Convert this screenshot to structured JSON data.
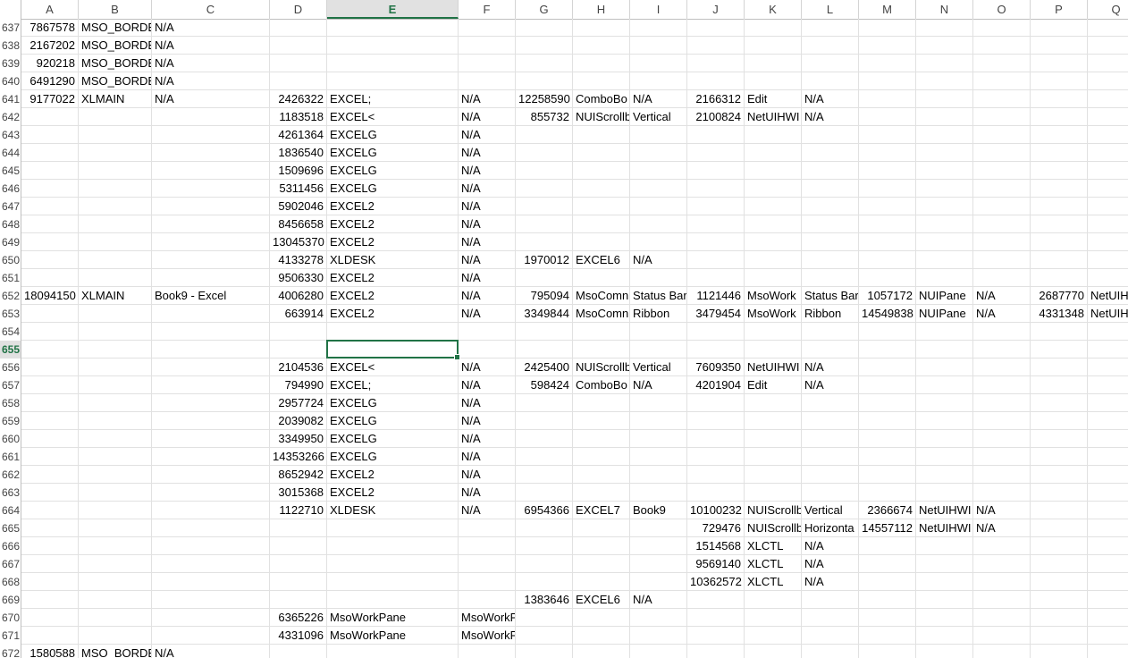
{
  "sheet": {
    "columns": [
      "A",
      "B",
      "C",
      "D",
      "E",
      "F",
      "G",
      "H",
      "I",
      "J",
      "K",
      "L",
      "M",
      "N",
      "O",
      "P",
      "Q"
    ],
    "active_column": "E",
    "active_row": "655",
    "rows": [
      {
        "n": "637",
        "cells": {
          "A": "7867578",
          "B": "MSO_BORDE",
          "C": "N/A"
        }
      },
      {
        "n": "638",
        "cells": {
          "A": "2167202",
          "B": "MSO_BORDE",
          "C": "N/A"
        }
      },
      {
        "n": "639",
        "cells": {
          "A": "920218",
          "B": "MSO_BORDE",
          "C": "N/A"
        }
      },
      {
        "n": "640",
        "cells": {
          "A": "6491290",
          "B": "MSO_BORDE",
          "C": "N/A"
        }
      },
      {
        "n": "641",
        "cells": {
          "A": "9177022",
          "B": "XLMAIN",
          "C": "N/A",
          "D": "2426322",
          "E": "EXCEL;",
          "F": "N/A",
          "G": "12258590",
          "H": "ComboBo",
          "I": "N/A",
          "J": "2166312",
          "K": "Edit",
          "L": "N/A"
        }
      },
      {
        "n": "642",
        "cells": {
          "D": "1183518",
          "E": "EXCEL<",
          "F": "N/A",
          "G": "855732",
          "H": "NUIScrollb",
          "I": "Vertical",
          "J": "2100824",
          "K": "NetUIHWI",
          "L": "N/A"
        }
      },
      {
        "n": "643",
        "cells": {
          "D": "4261364",
          "E": "EXCELG",
          "F": "N/A"
        }
      },
      {
        "n": "644",
        "cells": {
          "D": "1836540",
          "E": "EXCELG",
          "F": "N/A"
        }
      },
      {
        "n": "645",
        "cells": {
          "D": "1509696",
          "E": "EXCELG",
          "F": "N/A"
        }
      },
      {
        "n": "646",
        "cells": {
          "D": "5311456",
          "E": "EXCELG",
          "F": "N/A"
        }
      },
      {
        "n": "647",
        "cells": {
          "D": "5902046",
          "E": "EXCEL2",
          "F": "N/A"
        }
      },
      {
        "n": "648",
        "cells": {
          "D": "8456658",
          "E": "EXCEL2",
          "F": "N/A"
        }
      },
      {
        "n": "649",
        "cells": {
          "D": "13045370",
          "E": "EXCEL2",
          "F": "N/A"
        }
      },
      {
        "n": "650",
        "cells": {
          "D": "4133278",
          "E": "XLDESK",
          "F": "N/A",
          "G": "1970012",
          "H": "EXCEL6",
          "I": "N/A"
        }
      },
      {
        "n": "651",
        "cells": {
          "D": "9506330",
          "E": "EXCEL2",
          "F": "N/A"
        }
      },
      {
        "n": "652",
        "cells": {
          "A": "18094150",
          "B": "XLMAIN",
          "C": "Book9 - Excel",
          "D": "4006280",
          "E": "EXCEL2",
          "F": "N/A",
          "G": "795094",
          "H": "MsoComn",
          "I": "Status Bar",
          "J": "1121446",
          "K": "MsoWork",
          "L": "Status Bar",
          "M": "1057172",
          "N": "NUIPane",
          "O": "N/A",
          "P": "2687770",
          "Q": "NetUIH"
        }
      },
      {
        "n": "653",
        "cells": {
          "D": "663914",
          "E": "EXCEL2",
          "F": "N/A",
          "G": "3349844",
          "H": "MsoComn",
          "I": "Ribbon",
          "J": "3479454",
          "K": "MsoWork",
          "L": "Ribbon",
          "M": "14549838",
          "N": "NUIPane",
          "O": "N/A",
          "P": "4331348",
          "Q": "NetUIH"
        }
      },
      {
        "n": "654",
        "cells": {}
      },
      {
        "n": "655",
        "cells": {}
      },
      {
        "n": "656",
        "cells": {
          "D": "2104536",
          "E": "EXCEL<",
          "F": "N/A",
          "G": "2425400",
          "H": "NUIScrollb",
          "I": "Vertical",
          "J": "7609350",
          "K": "NetUIHWI",
          "L": "N/A"
        }
      },
      {
        "n": "657",
        "cells": {
          "D": "794990",
          "E": "EXCEL;",
          "F": "N/A",
          "G": "598424",
          "H": "ComboBo",
          "I": "N/A",
          "J": "4201904",
          "K": "Edit",
          "L": "N/A"
        }
      },
      {
        "n": "658",
        "cells": {
          "D": "2957724",
          "E": "EXCELG",
          "F": "N/A"
        }
      },
      {
        "n": "659",
        "cells": {
          "D": "2039082",
          "E": "EXCELG",
          "F": "N/A"
        }
      },
      {
        "n": "660",
        "cells": {
          "D": "3349950",
          "E": "EXCELG",
          "F": "N/A"
        }
      },
      {
        "n": "661",
        "cells": {
          "D": "14353266",
          "E": "EXCELG",
          "F": "N/A"
        }
      },
      {
        "n": "662",
        "cells": {
          "D": "8652942",
          "E": "EXCEL2",
          "F": "N/A"
        }
      },
      {
        "n": "663",
        "cells": {
          "D": "3015368",
          "E": "EXCEL2",
          "F": "N/A"
        }
      },
      {
        "n": "664",
        "cells": {
          "D": "1122710",
          "E": "XLDESK",
          "F": "N/A",
          "G": "6954366",
          "H": "EXCEL7",
          "I": "Book9",
          "J": "10100232",
          "K": "NUIScrollb",
          "L": "Vertical",
          "M": "2366674",
          "N": "NetUIHWI",
          "O": "N/A"
        }
      },
      {
        "n": "665",
        "cells": {
          "J": "729476",
          "K": "NUIScrollb",
          "L": "Horizonta",
          "M": "14557112",
          "N": "NetUIHWI",
          "O": "N/A"
        }
      },
      {
        "n": "666",
        "cells": {
          "J": "1514568",
          "K": "XLCTL",
          "L": "N/A"
        }
      },
      {
        "n": "667",
        "cells": {
          "J": "9569140",
          "K": "XLCTL",
          "L": "N/A"
        }
      },
      {
        "n": "668",
        "cells": {
          "J": "10362572",
          "K": "XLCTL",
          "L": "N/A"
        }
      },
      {
        "n": "669",
        "cells": {
          "G": "1383646",
          "H": "EXCEL6",
          "I": "N/A"
        }
      },
      {
        "n": "670",
        "cells": {
          "D": "6365226",
          "E": "MsoWorkPane",
          "F": "MsoWorkPane"
        }
      },
      {
        "n": "671",
        "cells": {
          "D": "4331096",
          "E": "MsoWorkPane",
          "F": "MsoWorkPane"
        }
      },
      {
        "n": "672",
        "cells": {
          "A": "1580588",
          "B": "MSO_BORDE",
          "C": "N/A"
        }
      }
    ]
  }
}
